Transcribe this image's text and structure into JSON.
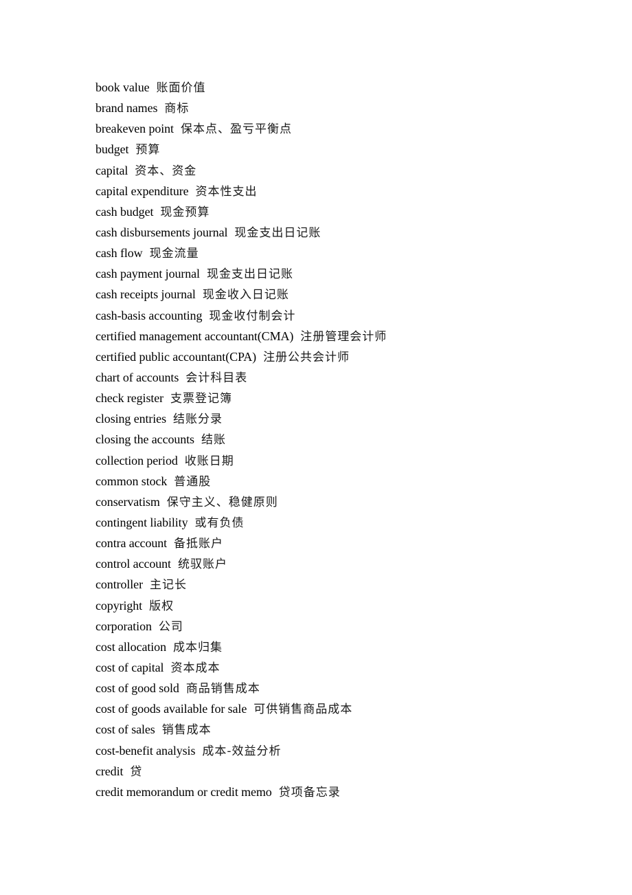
{
  "document": {
    "entries": [
      {
        "term": "book value",
        "translation": "账面价值"
      },
      {
        "term": "brand names",
        "translation": "商标"
      },
      {
        "term": "breakeven point",
        "translation": "保本点、盈亏平衡点"
      },
      {
        "term": "budget",
        "translation": "预算"
      },
      {
        "term": "capital",
        "translation": "资本、资金"
      },
      {
        "term": "capital expenditure",
        "translation": "资本性支出"
      },
      {
        "term": "cash budget",
        "translation": "现金预算"
      },
      {
        "term": "cash disbursements journal",
        "translation": "现金支出日记账"
      },
      {
        "term": "cash flow",
        "translation": "现金流量"
      },
      {
        "term": "cash payment journal",
        "translation": "现金支出日记账"
      },
      {
        "term": "cash receipts journal",
        "translation": "现金收入日记账"
      },
      {
        "term": "cash-basis accounting",
        "translation": "现金收付制会计"
      },
      {
        "term": "certified management accountant(CMA)",
        "translation": "注册管理会计师"
      },
      {
        "term": "certified public accountant(CPA)",
        "translation": "注册公共会计师"
      },
      {
        "term": "chart of accounts",
        "translation": "会计科目表"
      },
      {
        "term": "check register",
        "translation": "支票登记簿"
      },
      {
        "term": "closing entries",
        "translation": "结账分录"
      },
      {
        "term": "closing the accounts",
        "translation": "结账"
      },
      {
        "term": "collection period",
        "translation": "收账日期"
      },
      {
        "term": "common stock",
        "translation": "普通股"
      },
      {
        "term": "conservatism",
        "translation": "保守主义、稳健原则"
      },
      {
        "term": "contingent liability",
        "translation": "或有负债"
      },
      {
        "term": "contra account",
        "translation": "备抵账户"
      },
      {
        "term": "control account",
        "translation": "统驭账户"
      },
      {
        "term": "controller",
        "translation": "主记长"
      },
      {
        "term": "copyright",
        "translation": "版权"
      },
      {
        "term": "corporation",
        "translation": "公司"
      },
      {
        "term": "cost allocation",
        "translation": "成本归集"
      },
      {
        "term": "cost of capital",
        "translation": "资本成本"
      },
      {
        "term": "cost of good sold",
        "translation": "商品销售成本"
      },
      {
        "term": "cost of goods available for sale",
        "translation": "可供销售商品成本"
      },
      {
        "term": "cost of sales",
        "translation": "销售成本"
      },
      {
        "term": "cost-benefit analysis",
        "translation": "成本-效益分析"
      },
      {
        "term": "credit",
        "translation": "贷"
      },
      {
        "term": "credit memorandum or credit memo",
        "translation": "贷项备忘录"
      }
    ]
  }
}
